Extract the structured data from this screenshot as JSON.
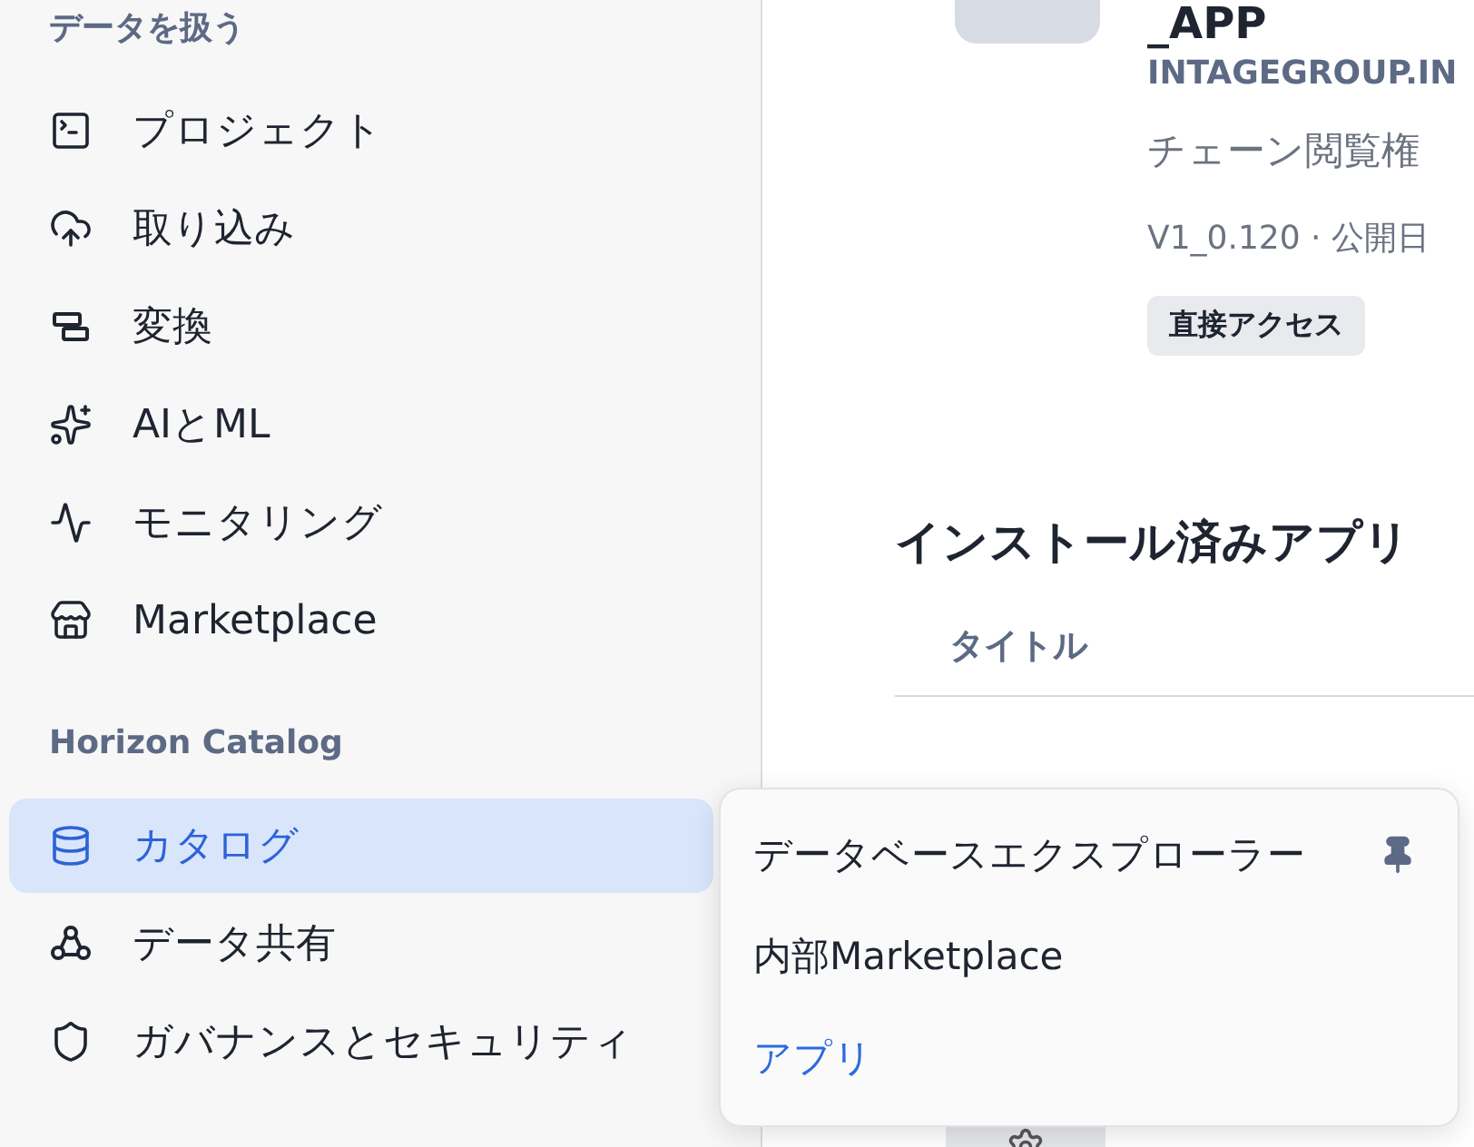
{
  "sidebar": {
    "sections": [
      {
        "label": "データを扱う",
        "items": [
          {
            "label": "プロジェクト",
            "selected": false
          },
          {
            "label": "取り込み",
            "selected": false
          },
          {
            "label": "変換",
            "selected": false
          },
          {
            "label": "AIとML",
            "selected": false
          },
          {
            "label": "モニタリング",
            "selected": false
          },
          {
            "label": "Marketplace",
            "selected": false
          }
        ]
      },
      {
        "label": "Horizon Catalog",
        "items": [
          {
            "label": "カタログ",
            "selected": true
          },
          {
            "label": "データ共有",
            "selected": false
          },
          {
            "label": "ガバナンスとセキュリティ",
            "selected": false
          }
        ]
      }
    ]
  },
  "app_detail": {
    "title": "_APP",
    "provider": "INTAGEGROUP.IN",
    "description": "チェーン閲覧権",
    "meta": "V1_0.120 · 公開日",
    "badge": "直接アクセス"
  },
  "installed_apps": {
    "heading": "インストール済みアプリ",
    "columns": [
      "タイトル"
    ]
  },
  "flyout_menu": {
    "items": [
      {
        "label": "データベースエクスプローラー",
        "pinned": true,
        "selected": false
      },
      {
        "label": "内部Marketplace",
        "pinned": false,
        "selected": false
      },
      {
        "label": "アプリ",
        "pinned": false,
        "selected": true
      }
    ]
  }
}
